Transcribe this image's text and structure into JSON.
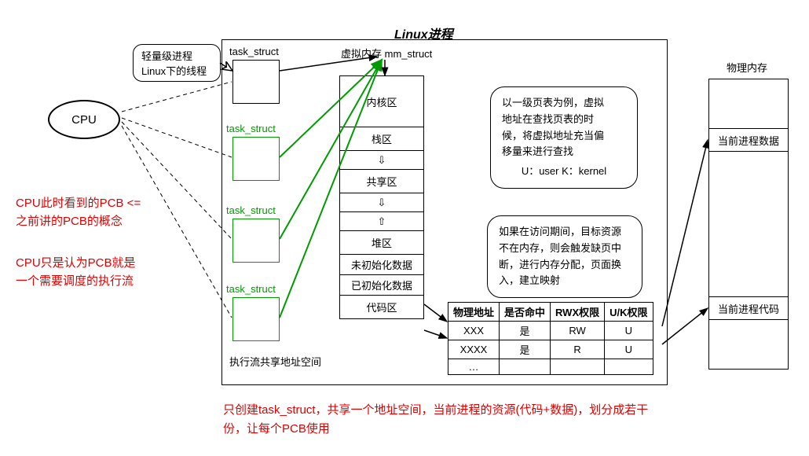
{
  "title": "Linux进程",
  "speech": {
    "line1": "轻量级进程",
    "line2": "Linux下的线程"
  },
  "cpu_label": "CPU",
  "task_struct_label": "task_struct",
  "green_task_label_1": "task_struct",
  "green_task_label_2": "task_struct",
  "green_task_label_3": "task_struct",
  "vm_label": "虚拟内存 mm_struct",
  "mem_regions": {
    "r1": "内核区",
    "r2": "栈区",
    "r3": "共享区",
    "r4": "堆区",
    "r5": "未初始化数据",
    "r6": "已初始化数据",
    "r7": "代码区"
  },
  "shared_space_label": "执行流共享地址空间",
  "note1": {
    "l1": "以一级页表为例，虚拟",
    "l2": "地址在查找页表的时",
    "l3": "候，将虚拟地址充当偏",
    "l4": "移量来进行查找",
    "l5": "U：user  K：kernel"
  },
  "note2": {
    "l1": "如果在访问期间，目标资源",
    "l2": "不在内存，则会触发缺页中",
    "l3": "断，进行内存分配，页面换",
    "l4": "入，建立映射"
  },
  "pagetable": {
    "h1": "物理地址",
    "h2": "是否命中",
    "h3": "RWX权限",
    "h4": "U/K权限",
    "r1c1": "XXX",
    "r1c2": "是",
    "r1c3": "RW",
    "r1c4": "U",
    "r2c1": "XXXX",
    "r2c2": "是",
    "r2c3": "R",
    "r2c4": "U",
    "r3c1": "…",
    "r3c2": "",
    "r3c3": "",
    "r3c4": ""
  },
  "phys_mem_label": "物理内存",
  "phys_data": "当前进程数据",
  "phys_code": "当前进程代码",
  "red_note_1a": "CPU此时看到的PCB <=",
  "red_note_1b": "之前讲的PCB的概念",
  "red_note_2a": "CPU只是认为PCB就是",
  "red_note_2b": "一个需要调度的执行流",
  "red_note_3a": "只创建task_struct，共享一个地址空间，当前进程的资源(代码+数据)，划分成若干",
  "red_note_3b": "份，让每个PCB使用"
}
